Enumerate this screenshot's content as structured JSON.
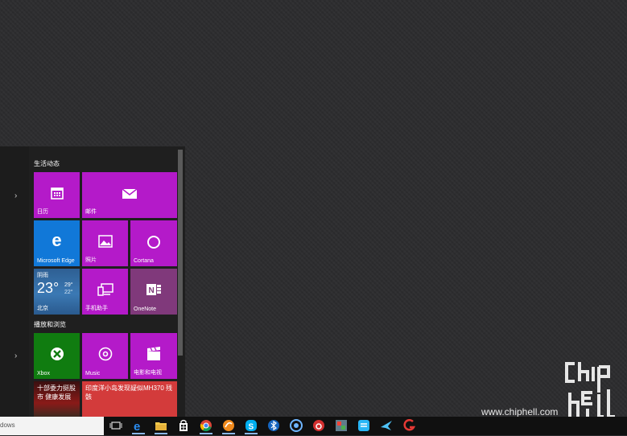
{
  "start_menu": {
    "groups": [
      {
        "title": "生活动态"
      },
      {
        "title": "播放和浏览"
      }
    ],
    "tiles": {
      "calendar": "日历",
      "mail": "邮件",
      "edge": "Microsoft Edge",
      "photos": "照片",
      "cortana": "Cortana",
      "weather": {
        "condition": "阴雨",
        "temp": "23°",
        "high": "29°",
        "low": "22°",
        "city": "北京"
      },
      "phone": "手机助手",
      "onenote": "OneNote",
      "xbox": "Xbox",
      "music": "Music",
      "movies": "电影和电视",
      "news1": "十部委力挺股市 健康发展",
      "news2": "印度洋小岛发现疑似MH370 残骸"
    }
  },
  "taskbar": {
    "search_text": "dows"
  },
  "watermark": {
    "url": "www.chiphell.com"
  },
  "colors": {
    "tile_purple": "#b41ac9",
    "tile_blue": "#1178d8",
    "tile_green": "#107c10",
    "onenote": "#80397b"
  }
}
